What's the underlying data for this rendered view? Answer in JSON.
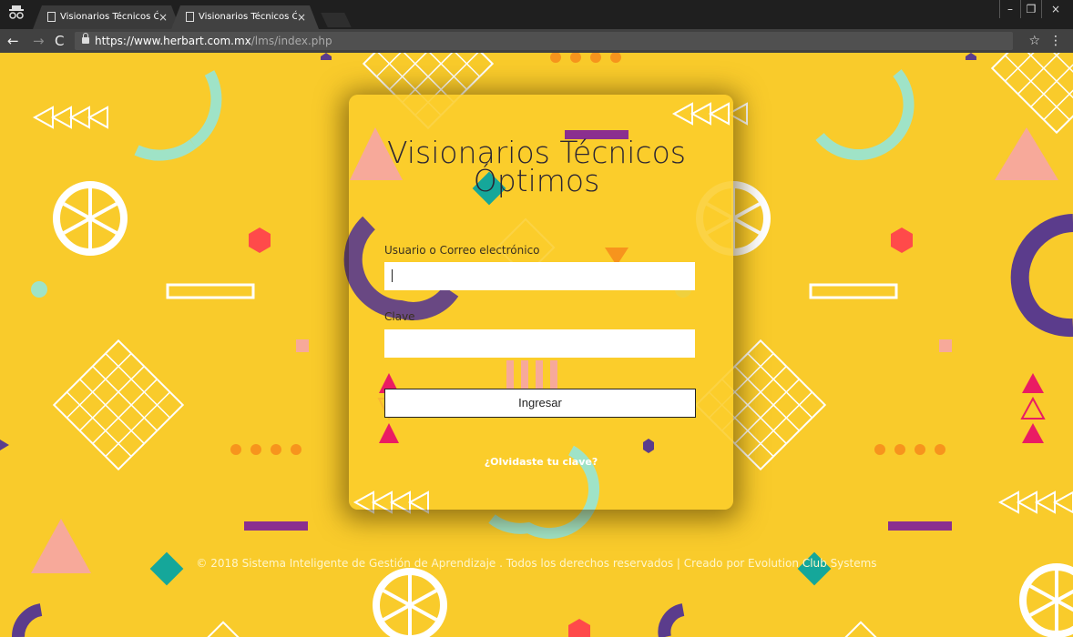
{
  "browser": {
    "tabs": [
      {
        "title": "Visionarios Técnicos Óptimos"
      },
      {
        "title": "Visionarios Técnicos Óptimos"
      }
    ],
    "window_buttons": {
      "minimize": "–",
      "maximize": "❐",
      "close": "×"
    },
    "tab_close": "×",
    "url_host": "https://www.herbart.com.mx",
    "url_path": "/lms/index.php",
    "icons": [
      "incognito-icon",
      "document-icon",
      "back-icon",
      "forward-icon",
      "reload-icon",
      "lock-icon",
      "star-icon",
      "menu-icon"
    ]
  },
  "login": {
    "title_line1": "Visionarios Técnicos",
    "title_line2": "Óptimos",
    "username_label": "Usuario o Correo electrónico",
    "username_value": "",
    "password_label": "Clave",
    "password_value": "",
    "submit_label": "Ingresar",
    "forgot_link": "¿Olvidaste tu clave?"
  },
  "footer": {
    "text": "© 2018 Sistema Inteligente de Gestión de Aprendizaje . Todos los derechos reservados | Creado por Evolution Club Systems"
  },
  "colors": {
    "background": "#f9cb2b",
    "purple": "#5b3c8c",
    "mint": "#9fe3c7",
    "pink": "#f7a99a",
    "red": "#ff4a4a",
    "magenta": "#ea1c63",
    "teal": "#15a79a",
    "orange": "#f7941d"
  }
}
